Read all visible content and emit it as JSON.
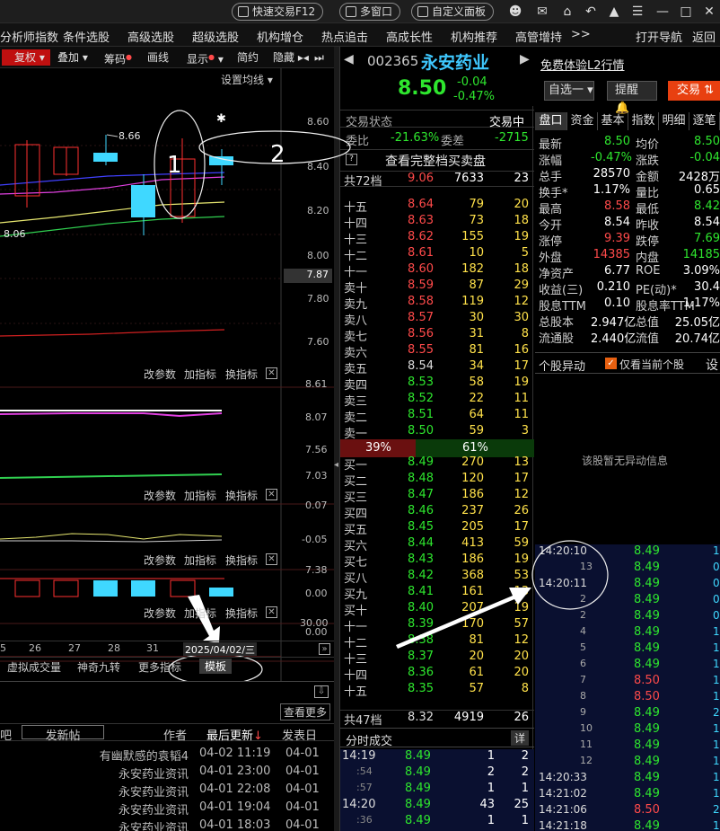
{
  "titlebar": {
    "quick_trade": "快速交易F12",
    "multi_window": "多窗口",
    "custom_panel": "自定义面板"
  },
  "menu": [
    "分析师指数",
    "条件选股",
    "高级选股",
    "超级选股",
    "机构增仓",
    "热点追击",
    "高成长性",
    "机构推荐",
    "高管增持",
    ">>",
    "打开导航",
    "返回"
  ],
  "left": {
    "toolbar": [
      "复权",
      "叠加",
      "筹码",
      "画线",
      "显示",
      "简约",
      "隐藏"
    ],
    "ma_setting": "设置均线",
    "price_axis": [
      "8.60",
      "8.40",
      "8.20",
      "8.00",
      "7.87",
      "7.80",
      "7.60"
    ],
    "last_marker": "7.87",
    "high_label": "8.66",
    "low_label": "8.06",
    "annotations": [
      "1",
      "2"
    ],
    "panel_controls": [
      "改参数",
      "加指标",
      "换指标"
    ],
    "ind1_axis": [
      "8.61",
      "8.07",
      "7.56",
      "7.03"
    ],
    "ind2_axis": [
      "0.07",
      "-0.05"
    ],
    "ind3_axis": [
      "7.38",
      "0.00"
    ],
    "ind4_axis": [
      "30.00",
      "0.00"
    ],
    "dates": [
      "5",
      "26",
      "27",
      "28",
      "31"
    ],
    "cursor_date": "2025/04/02/三",
    "bottom_tabs": [
      "虚拟成交量",
      "神奇九转",
      "更多指标",
      "模板"
    ],
    "news": {
      "view_more": "查看更多",
      "col_post": "发新帖",
      "col_author": "作者",
      "col_last": "最后更新",
      "col_date": "发表日",
      "left_stub": "吧",
      "rows": [
        [
          "有幽默感的袁韬4",
          "04-02 11:19",
          "04-01"
        ],
        [
          "永安药业资讯",
          "04-01 23:00",
          "04-01"
        ],
        [
          "永安药业资讯",
          "04-01 22:08",
          "04-01"
        ],
        [
          "永安药业资讯",
          "04-01 19:04",
          "04-01"
        ],
        [
          "永安药业资讯",
          "04-01 18:03",
          "04-01"
        ]
      ]
    }
  },
  "quote": {
    "code": "002365",
    "name": "永安药业",
    "price": "8.50",
    "change": "-0.04",
    "pct": "-0.47%",
    "l2": "免费体验L2行情",
    "watch": "自选一",
    "remind": "提醒",
    "trade": "交易"
  },
  "mid": {
    "status_label": "交易状态",
    "status": "交易中",
    "ratio_label": "委比",
    "ratio": "-21.63%",
    "diff_label": "委差",
    "diff": "-2715",
    "full_book": "查看完整档买卖盘",
    "ask_total": [
      "共72档",
      "9.06",
      "7633",
      "23"
    ],
    "asks": [
      [
        "十五",
        "8.64",
        "79",
        "20"
      ],
      [
        "十四",
        "8.63",
        "73",
        "18"
      ],
      [
        "十三",
        "8.62",
        "155",
        "19"
      ],
      [
        "十二",
        "8.61",
        "10",
        "5"
      ],
      [
        "十一",
        "8.60",
        "182",
        "18"
      ],
      [
        "卖十",
        "8.59",
        "87",
        "29"
      ],
      [
        "卖九",
        "8.58",
        "119",
        "12"
      ],
      [
        "卖八",
        "8.57",
        "30",
        "30"
      ],
      [
        "卖七",
        "8.56",
        "31",
        "8"
      ],
      [
        "卖六",
        "8.55",
        "81",
        "16"
      ],
      [
        "卖五",
        "8.54",
        "34",
        "17"
      ],
      [
        "卖四",
        "8.53",
        "58",
        "19"
      ],
      [
        "卖三",
        "8.52",
        "22",
        "11"
      ],
      [
        "卖二",
        "8.51",
        "64",
        "11"
      ],
      [
        "卖一",
        "8.50",
        "59",
        "3"
      ]
    ],
    "sell_pct": "39%",
    "buy_pct": "61%",
    "sell_frac": 0.39,
    "bids": [
      [
        "买一",
        "8.49",
        "270",
        "13"
      ],
      [
        "买二",
        "8.48",
        "120",
        "17"
      ],
      [
        "买三",
        "8.47",
        "186",
        "12"
      ],
      [
        "买四",
        "8.46",
        "237",
        "26"
      ],
      [
        "买五",
        "8.45",
        "205",
        "17"
      ],
      [
        "买六",
        "8.44",
        "413",
        "59"
      ],
      [
        "买七",
        "8.43",
        "186",
        "19"
      ],
      [
        "买八",
        "8.42",
        "368",
        "53"
      ],
      [
        "买九",
        "8.41",
        "161",
        "13"
      ],
      [
        "买十",
        "8.40",
        "207",
        "19"
      ],
      [
        "十一",
        "8.39",
        "170",
        "57"
      ],
      [
        "十二",
        "8.38",
        "81",
        "12"
      ],
      [
        "十三",
        "8.37",
        "20",
        "20"
      ],
      [
        "十四",
        "8.36",
        "61",
        "20"
      ],
      [
        "十五",
        "8.35",
        "57",
        "8"
      ]
    ],
    "bid_total": [
      "共47档",
      "8.32",
      "4919",
      "26"
    ],
    "trades_title": "分时成交",
    "trades_detail": "详",
    "trades": [
      [
        "14:19",
        "8.49",
        "1",
        "2"
      ],
      [
        ":54",
        "8.49",
        "2",
        "2"
      ],
      [
        ":57",
        "8.49",
        "1",
        "1"
      ],
      [
        "14:20",
        "8.49",
        "43",
        "25"
      ],
      [
        ":36",
        "8.49",
        "1",
        "1"
      ]
    ]
  },
  "right": {
    "tabs": [
      "盘口",
      "资金",
      "基本",
      "指数",
      "明细",
      "逐笔"
    ],
    "stats": [
      [
        "最新",
        "8.50",
        "均价",
        "8.50"
      ],
      [
        "涨幅",
        "-0.47%",
        "涨跌",
        "-0.04"
      ],
      [
        "总手",
        "28570",
        "金额",
        "2428万"
      ],
      [
        "换手*",
        "1.17%",
        "量比",
        "0.65"
      ],
      [
        "最高",
        "8.58",
        "最低",
        "8.42"
      ],
      [
        "今开",
        "8.54",
        "昨收",
        "8.54"
      ],
      [
        "涨停",
        "9.39",
        "跌停",
        "7.69"
      ],
      [
        "外盘",
        "14385",
        "内盘",
        "14185"
      ],
      [
        "净资产",
        "6.77",
        "ROE",
        "3.09%"
      ],
      [
        "收益(三)",
        "0.210",
        "PE(动)*",
        "30.4"
      ],
      [
        "股息TTM",
        "0.10",
        "股息率TTM",
        "1.17%"
      ],
      [
        "总股本",
        "2.947亿",
        "总值",
        "25.05亿"
      ],
      [
        "流通股",
        "2.440亿",
        "流值",
        "20.74亿"
      ]
    ],
    "moves_title": "个股异动",
    "moves_check": "仅看当前个股",
    "moves_set": "设",
    "moves_empty": "该股暂无异动信息",
    "ticks": [
      [
        "14:20:10",
        "8.49",
        "1"
      ],
      [
        "13",
        "8.49",
        "0"
      ],
      [
        "14:20:11",
        "8.49",
        "0"
      ],
      [
        "2",
        "8.49",
        "0"
      ],
      [
        "2",
        "8.49",
        "0"
      ],
      [
        "4",
        "8.49",
        "1"
      ],
      [
        "5",
        "8.49",
        "1"
      ],
      [
        "6",
        "8.49",
        "1"
      ],
      [
        "7",
        "8.50",
        "1"
      ],
      [
        "8",
        "8.50",
        "1"
      ],
      [
        "9",
        "8.49",
        "2"
      ],
      [
        "10",
        "8.49",
        "1"
      ],
      [
        "11",
        "8.49",
        "1"
      ],
      [
        "12",
        "8.49",
        "1"
      ],
      [
        "14:20:33",
        "8.49",
        "1"
      ],
      [
        "14:21:02",
        "8.49",
        "1"
      ],
      [
        "14:21:06",
        "8.50",
        "2"
      ],
      [
        "14:21:18",
        "8.49",
        "1"
      ]
    ]
  }
}
